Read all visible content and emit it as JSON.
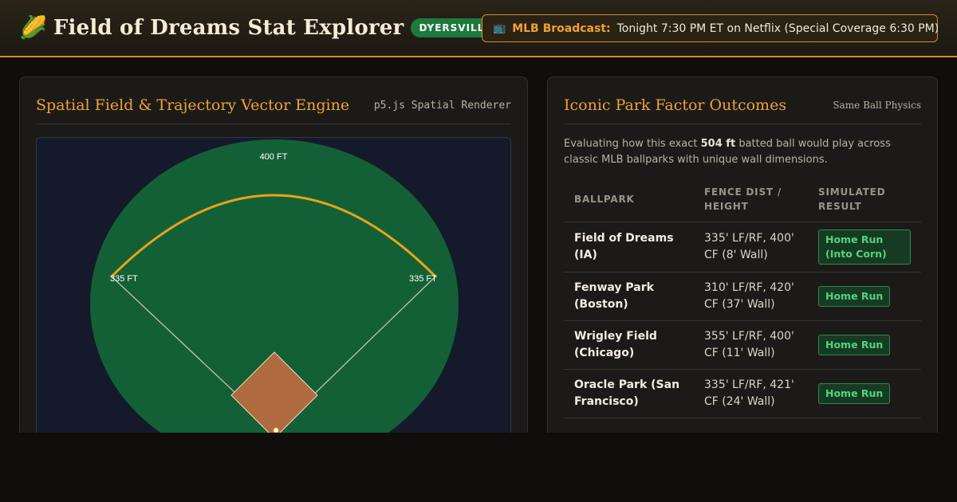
{
  "header": {
    "icon": "corn-icon",
    "title": "Field of Dreams Stat Explorer",
    "location_badge": "DYERSVILLE, IA",
    "broadcast": {
      "icon": "tv-icon",
      "label": "MLB Broadcast:",
      "text": "Tonight 7:30 PM ET on Netflix (Special Coverage 6:30 PM)"
    }
  },
  "left_panel": {
    "title": "Spatial Field & Trajectory Vector Engine",
    "tag": "p5.js Spatial Renderer",
    "field": {
      "center_label": "400 FT",
      "left_label": "335 FT",
      "right_label": "335 FT",
      "colors": {
        "canvas_bg": "#141a2b",
        "grass": "#146036",
        "infield": "#b06a3f",
        "fence": "#e9a21a",
        "foul_line": "#c9c2a6"
      }
    }
  },
  "right_panel": {
    "title": "Iconic Park Factor Outcomes",
    "tag": "Same Ball Physics",
    "desc_before": "Evaluating how this exact ",
    "desc_distance": "504 ft",
    "desc_after": " batted ball would play across classic MLB ballparks with unique wall dimensions.",
    "columns": [
      "BALLPARK",
      "FENCE DIST / HEIGHT",
      "SIMULATED RESULT"
    ],
    "rows": [
      {
        "park": "Field of Dreams (IA)",
        "fence": "335' LF/RF, 400' CF (8' Wall)",
        "result": "Home Run (Into Corn)"
      },
      {
        "park": "Fenway Park (Boston)",
        "fence": "310' LF/RF, 420' CF (37' Wall)",
        "result": "Home Run"
      },
      {
        "park": "Wrigley Field (Chicago)",
        "fence": "355' LF/RF, 400' CF (11' Wall)",
        "result": "Home Run"
      },
      {
        "park": "Oracle Park (San Francisco)",
        "fence": "335' LF/RF, 421' CF (24' Wall)",
        "result": "Home Run"
      }
    ]
  },
  "colors": {
    "accent": "#f0a22d",
    "success": "#4fd57c",
    "badge_green": "#1e7a3c"
  }
}
